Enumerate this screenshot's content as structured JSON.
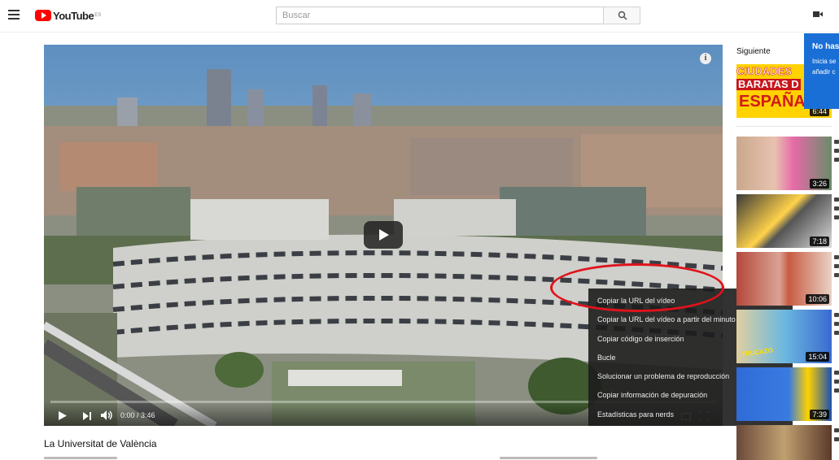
{
  "masthead": {
    "logo_text": "YouTube",
    "logo_country": "ES",
    "search_placeholder": "Buscar"
  },
  "player": {
    "time_display": "0:00 / 3:46",
    "progress": 0.0,
    "context_menu": [
      "Copiar la URL del vídeo",
      "Copiar la URL del vídeo a partir del minuto actual",
      "Copiar código de inserción",
      "Bucle",
      "Solucionar un problema de reproducción",
      "Copiar información de depuración",
      "Estadísticas para nerds"
    ],
    "highlight_color": "#e0131b"
  },
  "video": {
    "title": "La Universitat de València"
  },
  "sidebar": {
    "up_next_label": "Siguiente",
    "items": [
      {
        "thumbnail_text": [
          "CIUDADES",
          "BARATAS D",
          "ESPAÑA"
        ],
        "duration": "6:44"
      },
      {
        "duration": "3:26"
      },
      {
        "duration": "7:18"
      },
      {
        "duration": "10:06"
      },
      {
        "thumbnail_text": [
          "TRUCAZO"
        ],
        "duration": "15:04"
      },
      {
        "duration": "7:39"
      },
      {
        "duration": ""
      }
    ]
  },
  "popup": {
    "title": "No has",
    "lines": [
      "Inicia se",
      "añadir c"
    ]
  },
  "colors": {
    "brand_red": "#ff0000",
    "popup_blue": "#1a6fd6"
  }
}
